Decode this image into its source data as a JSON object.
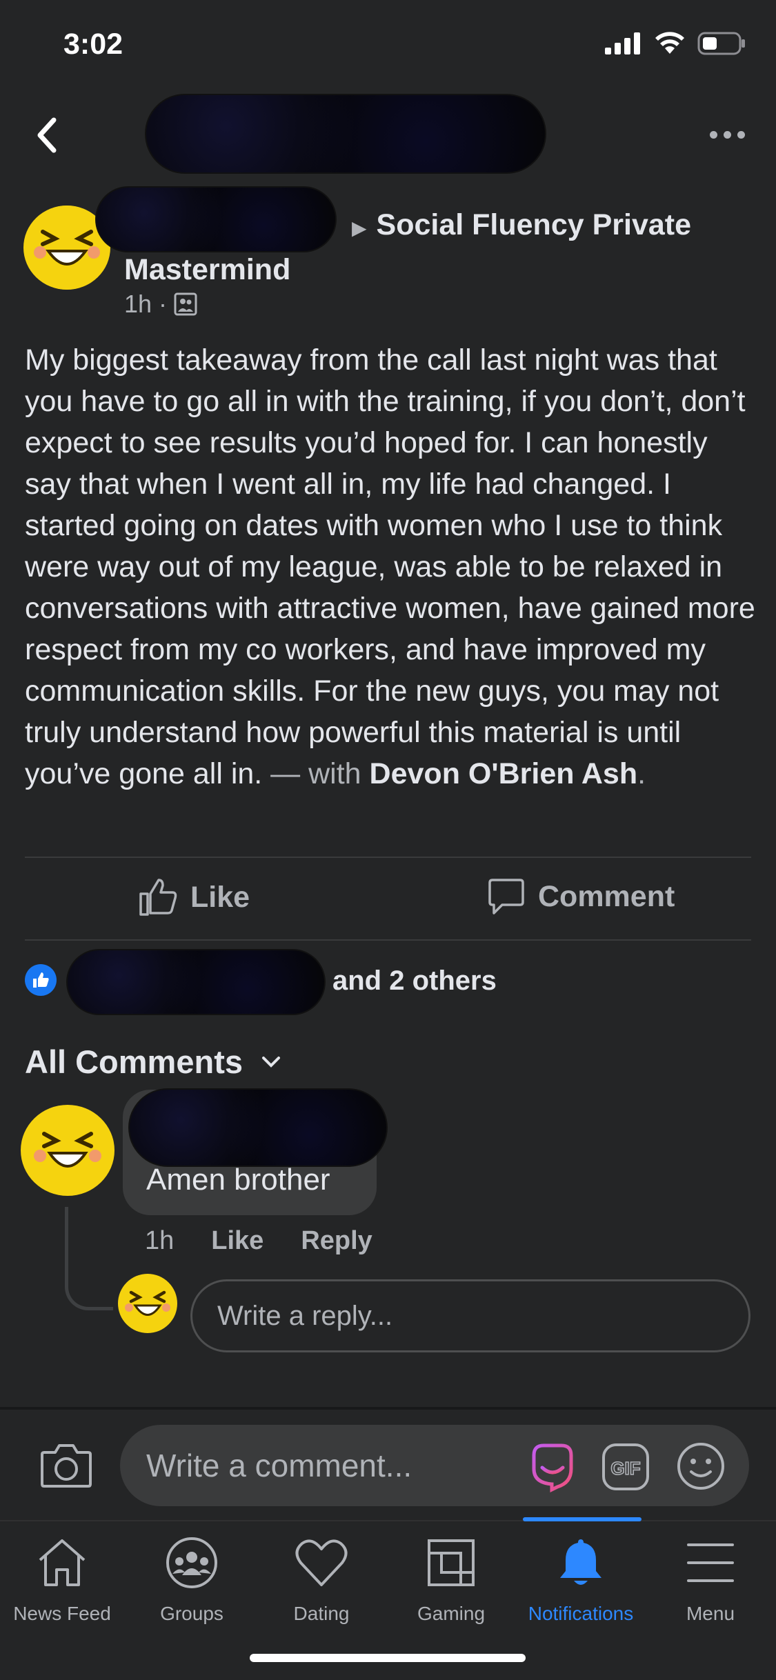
{
  "status_bar": {
    "time": "3:02"
  },
  "header": {
    "title_redacted": true
  },
  "post": {
    "author_redacted": true,
    "group_name": "Social Fluency Private Mastermind",
    "timestamp": "1h",
    "audience_icon": "group-audience-icon",
    "body": "My biggest takeaway from the call last night was that you have to go all in with the training, if you don’t, don’t expect to see results you’d hoped for. I can honestly say that when I went all in, my life had changed. I started going on dates with women who I use to think were way out of my league, was able to be relaxed in conversations with attractive women, have gained more respect from my co workers, and have improved my communication skills. For the new guys, you may not truly understand how powerful this material is until you’ve gone all in.",
    "tag_prefix": " — with ",
    "tagged_person": "Devon O'Brien Ash",
    "tag_suffix": "."
  },
  "actions": {
    "like_label": "Like",
    "comment_label": "Comment"
  },
  "reactions": {
    "others_text": "and 2 others"
  },
  "comments_section": {
    "heading": "All Comments",
    "comments": [
      {
        "author_redacted": true,
        "text": "Amen brother",
        "time": "1h",
        "like_label": "Like",
        "reply_label": "Reply"
      }
    ],
    "reply_placeholder": "Write a reply..."
  },
  "composer": {
    "placeholder": "Write a comment..."
  },
  "tabs": [
    {
      "label": "News Feed",
      "icon": "home-icon"
    },
    {
      "label": "Groups",
      "icon": "groups-icon"
    },
    {
      "label": "Dating",
      "icon": "heart-icon"
    },
    {
      "label": "Gaming",
      "icon": "gaming-icon"
    },
    {
      "label": "Notifications",
      "icon": "bell-icon",
      "active": true
    },
    {
      "label": "Menu",
      "icon": "hamburger-icon"
    }
  ],
  "colors": {
    "background": "#242526",
    "accent": "#2d88ff",
    "surface": "#3a3b3c",
    "text": "#e4e6eb",
    "muted": "#b0b3b8"
  }
}
